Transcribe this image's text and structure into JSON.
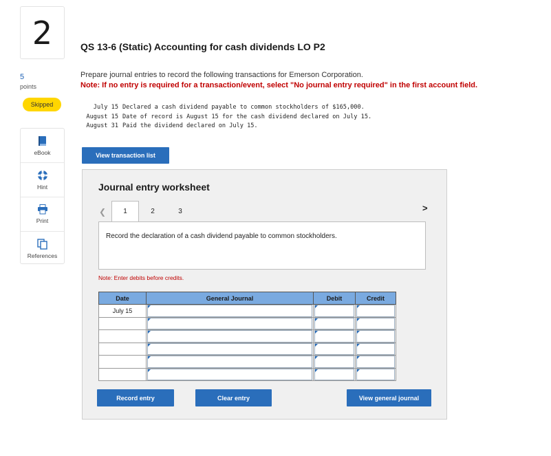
{
  "question": {
    "number": "2",
    "points_value": "5",
    "points_label": "points",
    "status": "Skipped",
    "title": "QS 13-6 (Static) Accounting for cash dividends LO P2",
    "instruction": "Prepare journal entries to record the following transactions for Emerson Corporation.",
    "note": "Note: If no entry is required for a transaction/event, select \"No journal entry required\" in the first account field.",
    "transactions": [
      {
        "date": "July 15",
        "text": "Declared a cash dividend payable to common stockholders of $165,000."
      },
      {
        "date": "August 15",
        "text": "Date of record is August 15 for the cash dividend declared on July 15."
      },
      {
        "date": "August 31",
        "text": "Paid the dividend declared on July 15."
      }
    ]
  },
  "tools": [
    {
      "label": "eBook",
      "icon": "book-icon"
    },
    {
      "label": "Hint",
      "icon": "lifebuoy-icon"
    },
    {
      "label": "Print",
      "icon": "printer-icon"
    },
    {
      "label": "References",
      "icon": "copy-icon"
    }
  ],
  "buttons": {
    "view_transaction_list": "View transaction list",
    "record_entry": "Record entry",
    "clear_entry": "Clear entry",
    "view_general_journal": "View general journal"
  },
  "worksheet": {
    "title": "Journal entry worksheet",
    "tabs": [
      "1",
      "2",
      "3"
    ],
    "active_tab": "1",
    "description": "Record the declaration of a cash dividend payable to common stockholders.",
    "enter_note": "Note: Enter debits before credits.",
    "columns": [
      "Date",
      "General Journal",
      "Debit",
      "Credit"
    ],
    "rows": [
      {
        "date": "July 15"
      },
      {
        "date": ""
      },
      {
        "date": ""
      },
      {
        "date": ""
      },
      {
        "date": ""
      },
      {
        "date": ""
      }
    ]
  },
  "colors": {
    "accent": "#2a6ebb",
    "skipped_badge": "#ffd600",
    "note_red": "#c00000",
    "table_header": "#7aaae0"
  }
}
